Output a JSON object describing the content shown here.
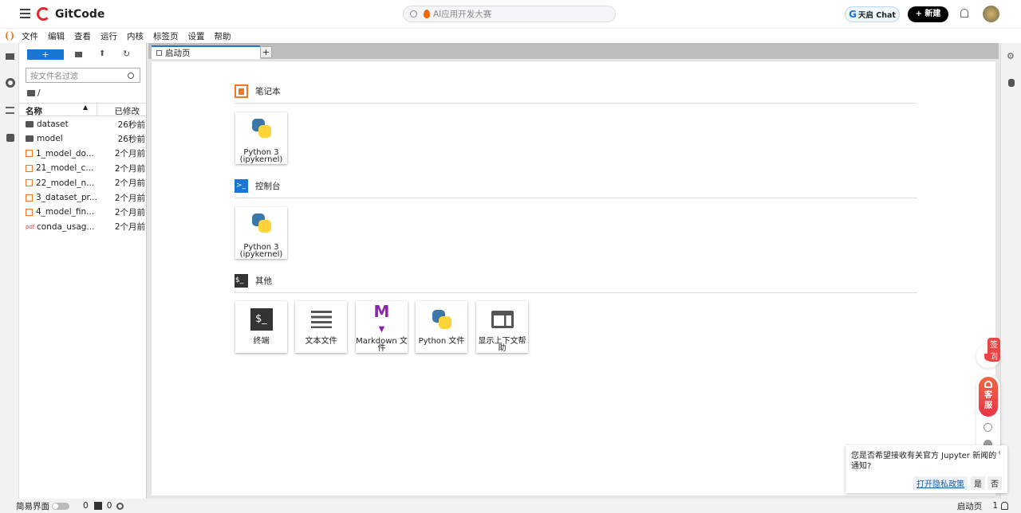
{
  "header": {
    "brand": "GitCode",
    "search_placeholder": "AI应用开发大赛",
    "chat_label": "天启 Chat",
    "new_label": "+ 新建"
  },
  "menu": [
    "文件",
    "编辑",
    "查看",
    "运行",
    "内核",
    "标签页",
    "设置",
    "帮助"
  ],
  "filebrowser": {
    "filter_placeholder": "按文件名过滤",
    "path": "/",
    "col_name": "名称",
    "col_modified": "已修改",
    "files": [
      {
        "name": "dataset",
        "modified": "26秒前",
        "type": "folder"
      },
      {
        "name": "model",
        "modified": "26秒前",
        "type": "folder"
      },
      {
        "name": "1_model_do...",
        "modified": "2个月前",
        "type": "notebook"
      },
      {
        "name": "21_model_c...",
        "modified": "2个月前",
        "type": "notebook"
      },
      {
        "name": "22_model_n...",
        "modified": "2个月前",
        "type": "notebook"
      },
      {
        "name": "3_dataset_pr...",
        "modified": "2个月前",
        "type": "notebook"
      },
      {
        "name": "4_model_fin...",
        "modified": "2个月前",
        "type": "notebook"
      },
      {
        "name": "conda_usag...",
        "modified": "2个月前",
        "type": "pdf"
      }
    ]
  },
  "tabs": [
    {
      "label": "启动页"
    }
  ],
  "launcher": {
    "notebook": {
      "title": "笔记本",
      "cards": [
        {
          "label": "Python 3 (ipykernel)"
        }
      ]
    },
    "console": {
      "title": "控制台",
      "cards": [
        {
          "label": "Python 3 (ipykernel)"
        }
      ]
    },
    "other": {
      "title": "其他",
      "cards": [
        {
          "label": "终端"
        },
        {
          "label": "文本文件"
        },
        {
          "label": "Markdown 文件"
        },
        {
          "label": "Python 文件"
        },
        {
          "label": "显示上下文帮助"
        }
      ]
    }
  },
  "floating": {
    "checkin": "签到",
    "service": "客服"
  },
  "notification": {
    "text": "您是否希望接收有关官方 Jupyter 新闻的通知?",
    "privacy": "打开隐私政策",
    "yes": "是",
    "no": "否"
  },
  "status": {
    "simple_mode": "简易界面",
    "terminals": "0",
    "kernels": "0",
    "active_tab": "启动页",
    "notifications": "1"
  },
  "colors": {
    "accent": "#1976d2",
    "brand": "#e3262d",
    "notebook": "#f37726"
  }
}
